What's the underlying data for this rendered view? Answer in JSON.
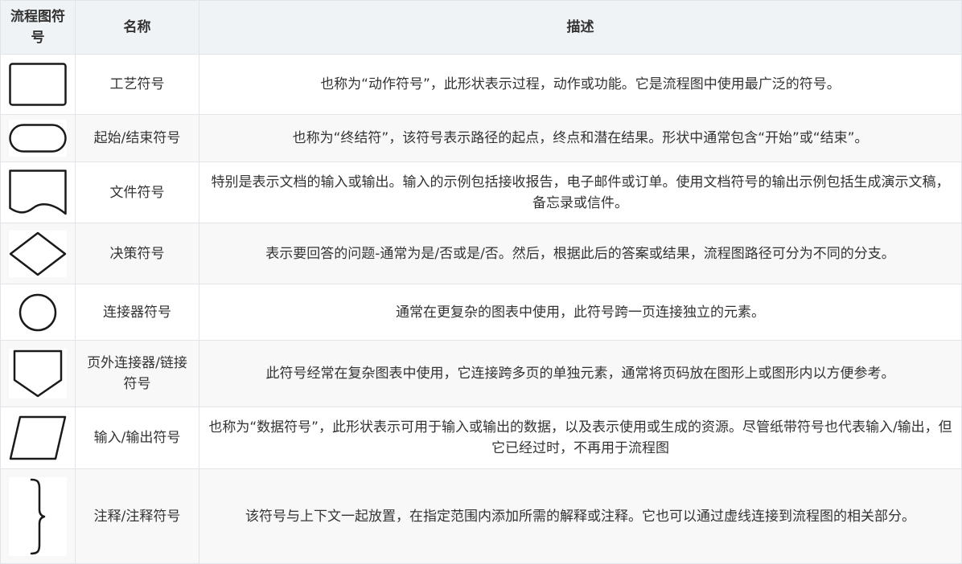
{
  "table": {
    "headers": {
      "symbol": "流程图符号",
      "name": "名称",
      "description": "描述"
    },
    "rows": [
      {
        "symbol_icon": "process-rectangle-icon",
        "name": "工艺符号",
        "description": "也称为“动作符号”，此形状表示过程，动作或功能。它是流程图中使用最广泛的符号。"
      },
      {
        "symbol_icon": "terminator-rounded-icon",
        "name": "起始/结束符号",
        "description": "也称为“终结符”，该符号表示路径的起点，终点和潜在结果。形状中通常包含“开始”或“结束”。"
      },
      {
        "symbol_icon": "document-wave-icon",
        "name": "文件符号",
        "description": "特别是表示文档的输入或输出。输入的示例包括接收报告，电子邮件或订单。使用文档符号的输出示例包括生成演示文稿，备忘录或信件。"
      },
      {
        "symbol_icon": "decision-diamond-icon",
        "name": "决策符号",
        "description": "表示要回答的问题-通常为是/否或是/否。然后，根据此后的答案或结果，流程图路径可分为不同的分支。"
      },
      {
        "symbol_icon": "connector-circle-icon",
        "name": "连接器符号",
        "description": "通常在更复杂的图表中使用，此符号跨一页连接独立的元素。"
      },
      {
        "symbol_icon": "off-page-pentagon-icon",
        "name": "页外连接器/链接符号",
        "description": "此符号经常在复杂图表中使用，它连接跨多页的单独元素，通常将页码放在图形上或图形内以方便参考。"
      },
      {
        "symbol_icon": "data-parallelogram-icon",
        "name": "输入/输出符号",
        "description": "也称为“数据符号”，此形状表示可用于输入或输出的数据，以及表示使用或生成的资源。尽管纸带符号也代表输入/输出，但它已经过时，不再用于流程图"
      },
      {
        "symbol_icon": "annotation-brace-icon",
        "name": "注释/注释符号",
        "description": "该符号与上下文一起放置，在指定范围内添加所需的解释或注释。它也可以通过虚线连接到流程图的相关部分。"
      }
    ]
  }
}
